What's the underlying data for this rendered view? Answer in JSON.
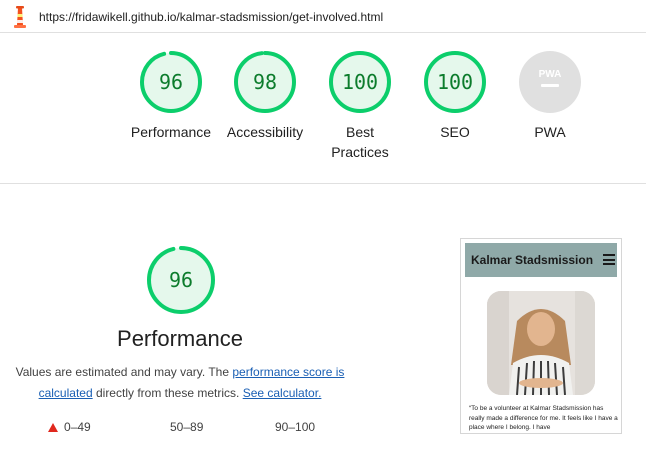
{
  "header": {
    "url": "https://fridawikell.github.io/kalmar-stadsmission/get-involved.html",
    "logo_icon": "lighthouse-icon"
  },
  "gauges": [
    {
      "label": "Performance",
      "score": "96",
      "fraction": 0.96,
      "color": "#0cce6b"
    },
    {
      "label": "Accessibility",
      "score": "98",
      "fraction": 0.98,
      "color": "#0cce6b"
    },
    {
      "label": "Best Practices",
      "line1": "Best",
      "line2": "Practices",
      "score": "100",
      "fraction": 1.0,
      "color": "#0cce6b"
    },
    {
      "label": "SEO",
      "score": "100",
      "fraction": 1.0,
      "color": "#0cce6b"
    },
    {
      "label": "PWA",
      "badge": "PWA",
      "color": "#9e9e9e"
    }
  ],
  "performance": {
    "score": "96",
    "fraction": 0.96,
    "title": "Performance",
    "desc_prefix": "Values are estimated and may vary. The ",
    "link1": "performance score is calculated",
    "desc_mid": " directly from these metrics. ",
    "link2": "See calculator."
  },
  "legend": {
    "fail": "0–49",
    "average": "50–89",
    "pass": "90–100"
  },
  "screenshot": {
    "site_title": "Kalmar Stadsmission",
    "quote": "“To be a volunteer at Kalmar Stadsmission has really made a difference for me. It feels like I have a place where I belong. I have"
  },
  "colors": {
    "pass": "#0cce6b",
    "pass_text": "#0c7c2c",
    "fail": "#e0281e",
    "link": "#1a5fb4",
    "pwa_gray": "#9e9e9e"
  }
}
